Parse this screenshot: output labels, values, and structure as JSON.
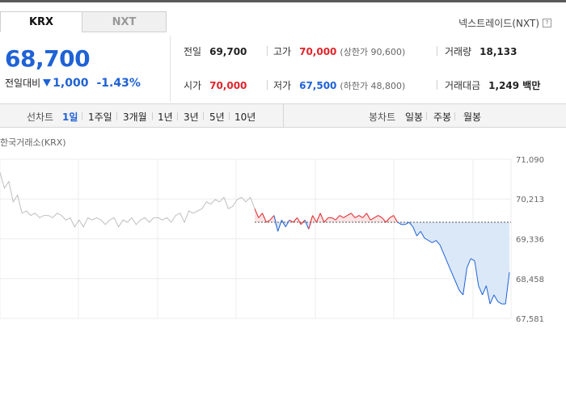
{
  "tabs": {
    "krx": "KRX",
    "nxt": "NXT"
  },
  "nextrade_label": "넥스트레이드(NXT)",
  "help_icon": "?",
  "price": "68,700",
  "change": {
    "label": "전일대비",
    "direction": "down",
    "amount": "1,000",
    "percent": "-1.43%"
  },
  "stats": {
    "prev_close": {
      "label": "전일",
      "value": "69,700"
    },
    "high": {
      "label": "고가",
      "value": "70,000",
      "sub": "(상한가 90,600)"
    },
    "volume": {
      "label": "거래량",
      "value": "18,133"
    },
    "open": {
      "label": "시가",
      "value": "70,000"
    },
    "low": {
      "label": "저가",
      "value": "67,500",
      "sub": "(하한가 48,800)"
    },
    "amount": {
      "label": "거래대금",
      "value": "1,249 백만"
    }
  },
  "periods": {
    "line_label": "선차트",
    "line": [
      "1일",
      "1주일",
      "3개월",
      "1년",
      "3년",
      "5년",
      "10년"
    ],
    "selected": "1일",
    "candle_label": "봉차트",
    "candle": [
      "일봉",
      "주봉",
      "월봉"
    ]
  },
  "chart_title": "한국거래소(KRX)",
  "colors": {
    "up": "#e0252b",
    "down": "#1f62d6",
    "prev": "#999999",
    "fill_up": "#fbe3e3",
    "fill_down": "#dbe8f8"
  },
  "chart_data": {
    "type": "line",
    "title": "한국거래소(KRX)",
    "yticks": [
      "71,090",
      "70,213",
      "69,336",
      "68,458",
      "67,581"
    ],
    "ylim": [
      67581,
      71090
    ],
    "baseline": 69700,
    "prev_day_series": [
      70800,
      70450,
      70600,
      70150,
      70300,
      69900,
      69950,
      69850,
      69900,
      69800,
      69850,
      69850,
      69800,
      69900,
      69850,
      69750,
      69800,
      69600,
      69750,
      69600,
      69800,
      69750,
      69800,
      69750,
      69650,
      69750,
      69800,
      69600,
      69750,
      69700,
      69800,
      69650,
      69750,
      69800,
      69700,
      69800,
      69800,
      69750,
      69800,
      69700,
      69850,
      69900,
      69700,
      69950,
      69900,
      69950,
      70000,
      70150,
      70100,
      70200,
      70150,
      70250,
      70000,
      70050,
      70200,
      70250,
      70150,
      70250,
      70000
    ],
    "today_series": [
      70000,
      69800,
      69900,
      69700,
      69750,
      69850,
      69500,
      69750,
      69600,
      69750,
      69700,
      69800,
      69650,
      69750,
      69550,
      69850,
      69700,
      69900,
      69700,
      69800,
      69800,
      69750,
      69850,
      69800,
      69850,
      69900,
      69800,
      69850,
      69800,
      69900,
      69750,
      69800,
      69850,
      69800,
      69700,
      69800,
      69850,
      69700,
      69650,
      69650,
      69700,
      69600,
      69400,
      69500,
      69350,
      69300,
      69250,
      69300,
      69200,
      69000,
      68800,
      68600,
      68400,
      68200,
      68100,
      68700,
      68900,
      68850,
      68300,
      68100,
      68300,
      67900,
      68100,
      67950,
      67900,
      67900,
      68600
    ]
  }
}
